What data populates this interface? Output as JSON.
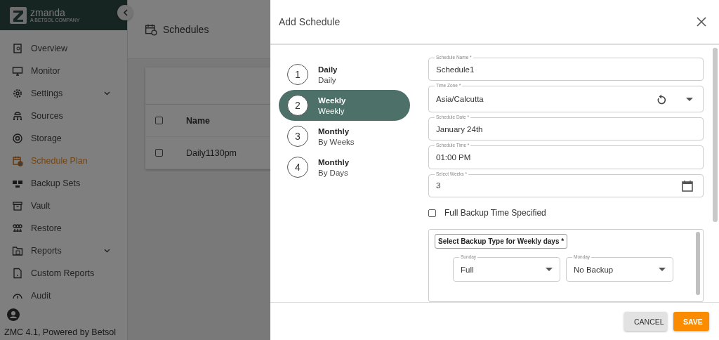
{
  "sidebar": {
    "logo": {
      "name": "zmanda",
      "tagline": "A BETSOL COMPANY"
    },
    "items": [
      {
        "label": "Overview",
        "selected": false,
        "expandable": false
      },
      {
        "label": "Monitor",
        "selected": false,
        "expandable": false
      },
      {
        "label": "Settings",
        "selected": false,
        "expandable": true
      },
      {
        "label": "Sources",
        "selected": false,
        "expandable": false
      },
      {
        "label": "Storage",
        "selected": false,
        "expandable": false
      },
      {
        "label": "Schedule Plan",
        "selected": true,
        "expandable": false
      },
      {
        "label": "Backup Sets",
        "selected": false,
        "expandable": false
      },
      {
        "label": "Vault",
        "selected": false,
        "expandable": false
      },
      {
        "label": "Restore",
        "selected": false,
        "expandable": false
      },
      {
        "label": "Reports",
        "selected": false,
        "expandable": true
      },
      {
        "label": "Custom Reports",
        "selected": false,
        "expandable": false
      },
      {
        "label": "Audit",
        "selected": false,
        "expandable": false
      }
    ],
    "footer": "ZMC 4.1, Powered by Betsol"
  },
  "page": {
    "title": "Schedules",
    "table": {
      "header_checked": false,
      "columns": [
        "Name"
      ],
      "rows": [
        {
          "name": "Daily1130pm",
          "checked": false
        }
      ]
    }
  },
  "dialog": {
    "title": "Add Schedule",
    "steps": [
      {
        "number": "1",
        "title": "Daily",
        "subtitle": "Daily",
        "selected": false
      },
      {
        "number": "2",
        "title": "Weekly",
        "subtitle": "Weekly",
        "selected": true
      },
      {
        "number": "3",
        "title": "Monthly",
        "subtitle": "By Weeks",
        "selected": false
      },
      {
        "number": "4",
        "title": "Monthly",
        "subtitle": "By Days",
        "selected": false
      }
    ],
    "fields": [
      {
        "kind": "text",
        "label": "Schedule Name *",
        "value": "Schedule1"
      },
      {
        "kind": "timezone",
        "label": "Time Zone *",
        "value": "Asia/Calcutta"
      },
      {
        "kind": "text",
        "label": "Schedule Date *",
        "value": "January 24th"
      },
      {
        "kind": "text",
        "label": "Schedule Time *",
        "value": "01:00 PM"
      },
      {
        "kind": "date",
        "label": "Select Weeks *",
        "value": "3"
      }
    ],
    "full_backup": {
      "label": "Full Backup Time Specified",
      "checked": false
    },
    "backup_types": {
      "title": "Select Backup Type for Weekly days *",
      "days": [
        {
          "label": "Sunday",
          "value": "Full"
        },
        {
          "label": "Monday",
          "value": "No Backup"
        }
      ]
    },
    "buttons": [
      {
        "kind": "secondary",
        "label": "CANCEL"
      },
      {
        "kind": "primary",
        "label": "SAVE"
      }
    ]
  }
}
